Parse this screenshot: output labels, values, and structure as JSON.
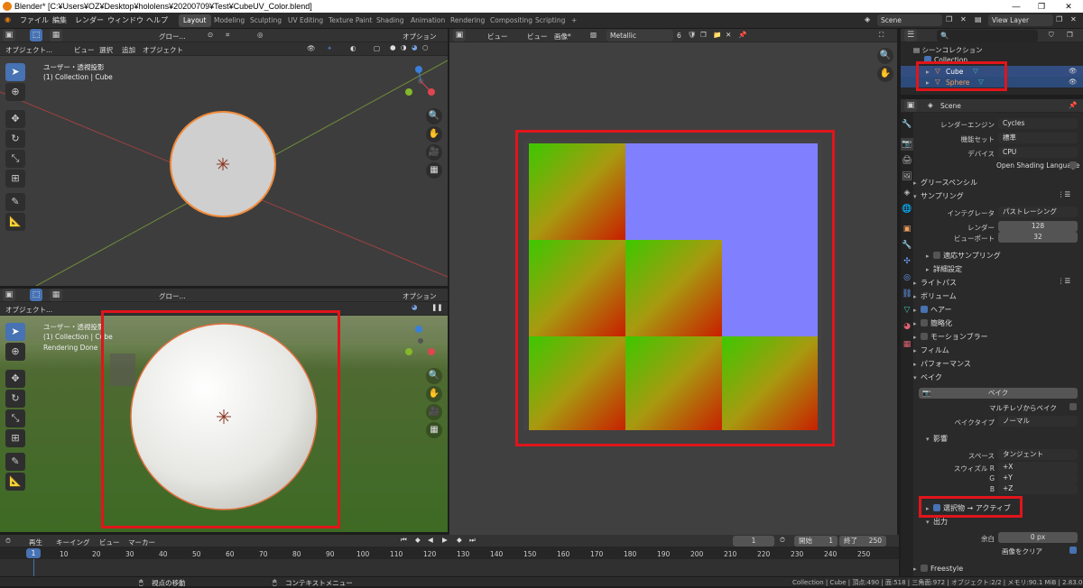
{
  "window": {
    "title": "Blender* [C:¥Users¥OZ¥Desktop¥hololens¥20200709¥Test¥CubeUV_Color.blend]",
    "minimize": "—",
    "maximize": "❐",
    "close": "✕"
  },
  "menu": [
    "ファイル",
    "編集",
    "レンダー",
    "ウィンドウ",
    "ヘルプ"
  ],
  "workspaces": [
    "Layout",
    "Modeling",
    "Sculpting",
    "UV Editing",
    "Texture Paint",
    "Shading",
    "Animation",
    "Rendering",
    "Compositing",
    "Scripting",
    "+"
  ],
  "topbar_right": {
    "scene": "Scene",
    "view_layer": "View Layer"
  },
  "viewport_top": {
    "header": {
      "mode": "オブジェクト...",
      "menus": [
        "ビュー",
        "選択",
        "追加",
        "オブジェクト"
      ],
      "orientation": "グロー...",
      "options": "オプション"
    },
    "overlay_lines": [
      "ユーザー・透視投影",
      "(1) Collection | Cube"
    ]
  },
  "viewport_bottom": {
    "header": {
      "mode": "オブジェクト...",
      "orientation": "グロー...",
      "options": "オプション"
    },
    "overlay_lines": [
      "ユーザー・透視投影",
      "(1) Collection | Cube",
      "Rendering Done"
    ]
  },
  "image_editor": {
    "menus": [
      "ビュー",
      "ビュー",
      "画像*"
    ],
    "image_name": "Metallic",
    "users": "6",
    "texture_colors": {
      "normal_flat": "#8080ff"
    }
  },
  "outliner": {
    "root": "シーンコレクション",
    "collection": "Collection",
    "items": [
      "Cube",
      "Sphere"
    ]
  },
  "properties": {
    "header": "Scene",
    "render_engine": {
      "label": "レンダーエンジン",
      "value": "Cycles"
    },
    "feature_set": {
      "label": "機能セット",
      "value": "標準"
    },
    "device": {
      "label": "デバイス",
      "value": "CPU"
    },
    "osl": "Open Shading Language",
    "grease_pencil": "グリースペンシル",
    "sampling": "サンプリング",
    "integrator": {
      "label": "インテグレータ",
      "value": "パストレーシング"
    },
    "render_samples": {
      "label": "レンダー",
      "value": "128"
    },
    "viewport_samples": {
      "label": "ビューポート",
      "value": "32"
    },
    "adaptive": "適応サンプリング",
    "advanced": "詳細設定",
    "light_paths": "ライトパス",
    "volumes": "ボリューム",
    "hair": "ヘアー",
    "simplify": "簡略化",
    "motion_blur": "モーションブラー",
    "film": "フィルム",
    "performance": "パフォーマンス",
    "bake": "ベイク",
    "bake_button": "ベイク",
    "multires": "マルチレゾからベイク",
    "bake_type": {
      "label": "ベイクタイプ",
      "value": "ノーマル"
    },
    "influence": "影響",
    "space": {
      "label": "スペース",
      "value": "タンジェント"
    },
    "swizzle_r": {
      "label": "スウィズル R",
      "value": "+X"
    },
    "swizzle_g": {
      "label": "G",
      "value": "+Y"
    },
    "swizzle_b": {
      "label": "B",
      "value": "+Z"
    },
    "selected_to_active": "選択物 → アクティブ",
    "output": "出力",
    "margin": {
      "label": "余白",
      "value": "0 px"
    },
    "clear_image": "画像をクリア",
    "freestyle": "Freestyle"
  },
  "timeline": {
    "menus": [
      "再生",
      "キーイング",
      "ビュー",
      "マーカー"
    ],
    "current_frame": "1",
    "start_label": "開始",
    "start": "1",
    "end_label": "終了",
    "end": "250",
    "ticks": [
      "1",
      "10",
      "20",
      "30",
      "40",
      "50",
      "60",
      "70",
      "80",
      "90",
      "100",
      "110",
      "120",
      "130",
      "140",
      "150",
      "160",
      "170",
      "180",
      "190",
      "200",
      "210",
      "220",
      "230",
      "240",
      "250"
    ]
  },
  "statusbar": {
    "nav": "視点の移動",
    "context": "コンテキストメニュー",
    "info": "Collection | Cube | 頂点:490 | 面:518 | 三角面:972 | オブジェクト:2/2 | メモリ:90.1 MiB | 2.83.0"
  }
}
